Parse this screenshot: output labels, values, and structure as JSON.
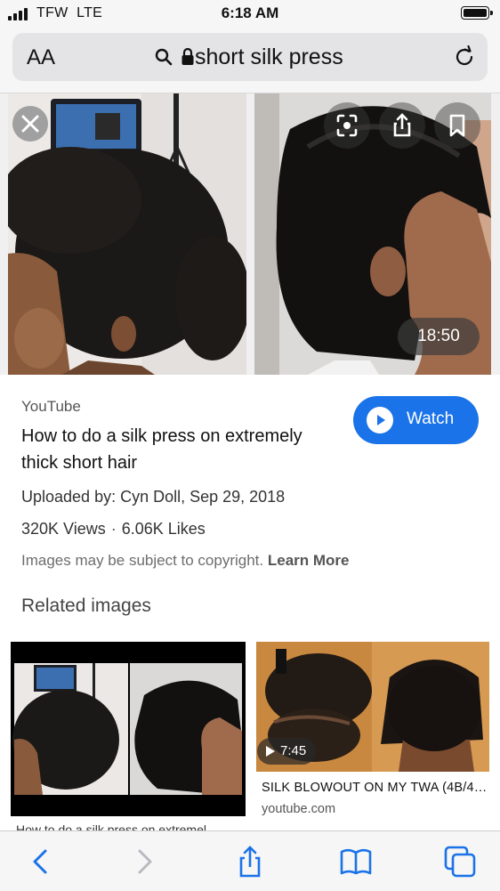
{
  "status_bar": {
    "carrier": "TFW",
    "network": "LTE",
    "time": "6:18 AM",
    "battery_level": 0.95
  },
  "address_bar": {
    "text_size_label": "AA",
    "url_text": "short silk press",
    "icons": [
      "search-icon",
      "lock-icon",
      "reload-icon"
    ]
  },
  "hero": {
    "duration": "18:50",
    "icons": [
      "close-icon",
      "lens-icon",
      "share-icon",
      "bookmark-icon"
    ]
  },
  "result": {
    "source": "YouTube",
    "title": "How to do a silk press on extremely thick short hair",
    "watch_label": "Watch",
    "uploaded": "Uploaded by: Cyn Doll, Sep 29, 2018",
    "views": "320K Views",
    "separator": "·",
    "likes": "6.06K Likes",
    "copyright_text": "Images may be subject to copyright.",
    "learn_more": "Learn More"
  },
  "related": {
    "heading": "Related images",
    "items": [
      {
        "caption": "How to do a silk press on extremel"
      },
      {
        "duration": "7:45",
        "title": "SILK BLOWOUT ON MY TWA (4B/4…",
        "domain": "youtube.com"
      }
    ]
  },
  "toolbar": {
    "icons": [
      "back-icon",
      "forward-icon",
      "share-icon",
      "bookmarks-icon",
      "tabs-icon"
    ]
  },
  "colors": {
    "accent": "#1a73e8",
    "toolbar_icons": "#1a73e8",
    "disabled_icon": "#b9b9bf"
  }
}
